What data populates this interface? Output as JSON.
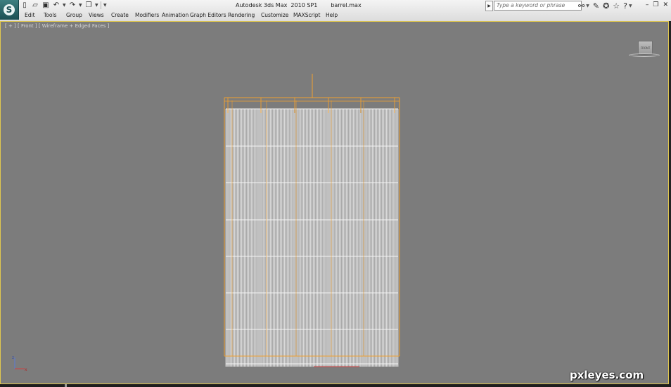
{
  "app": {
    "logo_glyph": "S",
    "title": "Autodesk 3ds Max  2010 SP1",
    "filename": "barrel.max"
  },
  "quick_access": [
    {
      "name": "new-file-icon",
      "glyph": "▯"
    },
    {
      "name": "open-file-icon",
      "glyph": "▱"
    },
    {
      "name": "save-icon",
      "glyph": "▣"
    },
    {
      "name": "undo-icon",
      "glyph": "↶"
    },
    {
      "name": "redo-icon",
      "glyph": "↷"
    },
    {
      "name": "project-folder-icon",
      "glyph": "❐"
    }
  ],
  "menu": [
    {
      "label": "Edit"
    },
    {
      "label": "Tools"
    },
    {
      "label": "Group"
    },
    {
      "label": "Views"
    },
    {
      "label": "Create"
    },
    {
      "label": "Modifiers"
    },
    {
      "label": "Animation"
    },
    {
      "label": "Graph Editors"
    },
    {
      "label": "Rendering"
    },
    {
      "label": "Customize"
    },
    {
      "label": "MAXScript"
    },
    {
      "label": "Help"
    }
  ],
  "search": {
    "placeholder": "Type a keyword or phrase"
  },
  "help_icons": [
    {
      "name": "binoculars-icon",
      "glyph": "⚯"
    },
    {
      "name": "communication-icon",
      "glyph": "✎"
    },
    {
      "name": "exchange-icon",
      "glyph": "✪"
    },
    {
      "name": "favorites-icon",
      "glyph": "☆"
    },
    {
      "name": "help-question-icon",
      "glyph": "?"
    }
  ],
  "window_controls": {
    "minimize": "–",
    "restore": "❐",
    "close": "✕"
  },
  "viewport": {
    "label": "[ + ] [ Front ] [ Wireframe + Edged Faces ]",
    "viewcube_face": "FRONT",
    "background": "#7c7c7c",
    "border_color": "#e1c84e"
  },
  "object": {
    "name": "barrel",
    "wire_color": "#ffffff",
    "selection_color": "#f0a030"
  },
  "axis": {
    "z": "z",
    "x": "x"
  },
  "watermark": "pxleyes.com"
}
